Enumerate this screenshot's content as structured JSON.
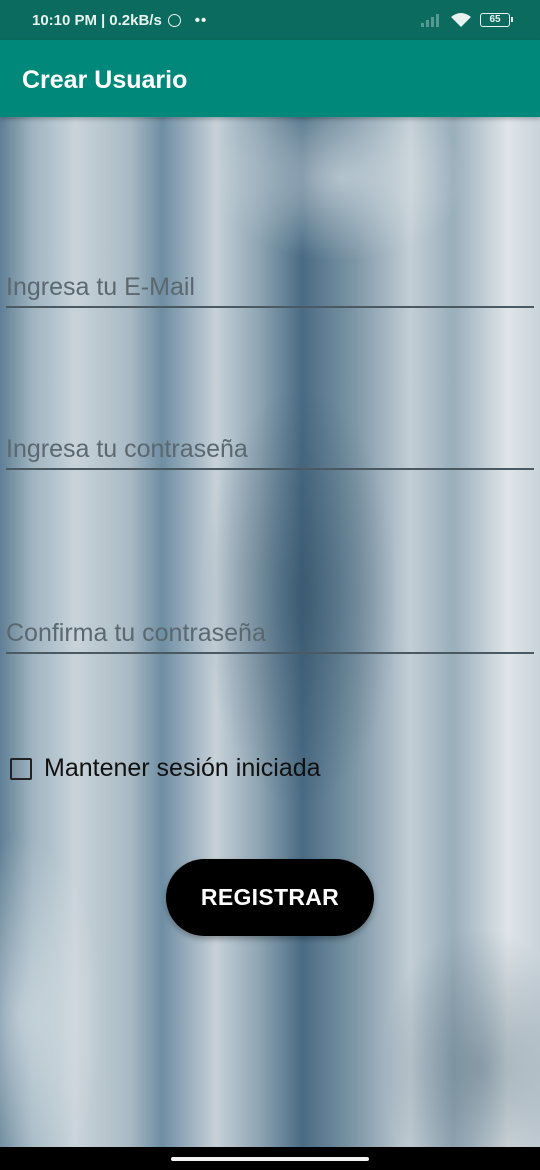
{
  "status_bar": {
    "time": "10:10 PM",
    "separator": "|",
    "speed": "0.2kB/s",
    "dots": "••",
    "battery_level": "65"
  },
  "app_bar": {
    "title": "Crear Usuario"
  },
  "form": {
    "email_placeholder": "Ingresa tu E-Mail",
    "email_value": "",
    "password_placeholder": "Ingresa tu contraseña",
    "password_value": "",
    "confirm_placeholder": "Confirma tu contraseña",
    "confirm_value": "",
    "keep_session_label": "Mantener sesión iniciada",
    "keep_session_checked": false,
    "register_label": "REGISTRAR"
  },
  "colors": {
    "status_bar": "#0a6b5e",
    "app_bar": "#00897b",
    "button": "#000000"
  },
  "icons": {
    "alarm": "alarm-icon",
    "signal": "signal-icon",
    "wifi": "wifi-icon",
    "battery": "battery-icon",
    "checkbox": "checkbox-icon"
  }
}
